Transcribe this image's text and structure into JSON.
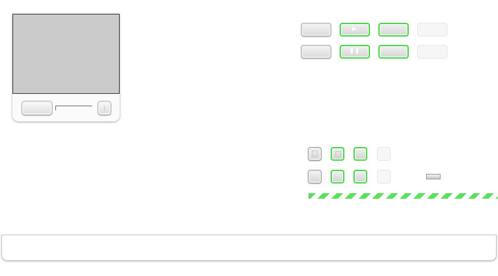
{
  "player": {
    "video_area": "",
    "play_button_label": "",
    "fullscreen_button_label": ""
  },
  "wide_buttons": [
    {
      "state": "normal",
      "glyph": ""
    },
    {
      "state": "highlighted",
      "glyph": "▶"
    },
    {
      "state": "highlighted",
      "glyph": ""
    },
    {
      "state": "disabled",
      "glyph": ""
    },
    {
      "state": "normal",
      "glyph": ""
    },
    {
      "state": "highlighted",
      "glyph": "❚❚"
    },
    {
      "state": "highlighted",
      "glyph": ""
    },
    {
      "state": "disabled",
      "glyph": ""
    }
  ],
  "square_buttons": [
    {
      "state": "normal"
    },
    {
      "state": "highlighted"
    },
    {
      "state": "highlighted"
    },
    {
      "state": "disabled"
    },
    {
      "state": "normal"
    },
    {
      "state": "highlighted"
    },
    {
      "state": "highlighted"
    },
    {
      "state": "disabled"
    }
  ],
  "progress": {
    "striped": true
  },
  "bottom_panel": {
    "text": ""
  },
  "colors": {
    "accent_green": "#4fd64f",
    "stripe_green": "#5ae05a",
    "video_gray": "#cbcbcb",
    "frame_dark": "#3a3a3a"
  }
}
